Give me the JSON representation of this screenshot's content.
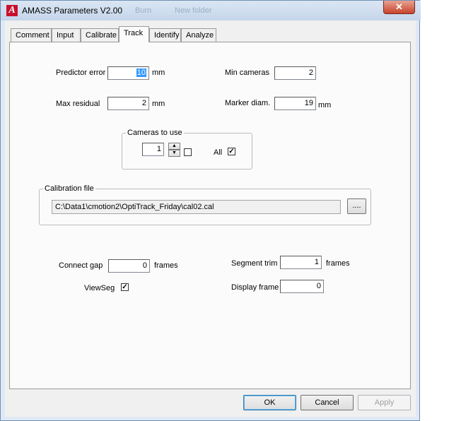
{
  "window": {
    "title": "AMASS Parameters V2.00",
    "ghost_items": [
      "Burn",
      "New folder"
    ],
    "app_icon_letter": "A",
    "close_glyph": "✕"
  },
  "tabs": [
    {
      "label": "Comment",
      "active": false
    },
    {
      "label": "Input",
      "active": false
    },
    {
      "label": "Calibrate",
      "active": false
    },
    {
      "label": "Track",
      "active": true
    },
    {
      "label": "Identify",
      "active": false
    },
    {
      "label": "Analyze",
      "active": false
    }
  ],
  "track": {
    "predictor_error": {
      "label": "Predictor error",
      "value": "10",
      "unit": "mm"
    },
    "max_residual": {
      "label": "Max residual",
      "value": "2",
      "unit": "mm"
    },
    "min_cameras": {
      "label": "Min cameras",
      "value": "2"
    },
    "marker_diam": {
      "label": "Marker diam.",
      "value": "19",
      "unit": "mm"
    },
    "cameras_to_use": {
      "title": "Cameras to use",
      "value": "1",
      "camera_checked": false,
      "all_label": "All",
      "all_checked": true
    },
    "calibration": {
      "title": "Calibration file",
      "path": "C:\\Data1\\cmotion2\\OptiTrack_Friday\\cal02.cal",
      "browse_label": "...."
    },
    "connect_gap": {
      "label": "Connect gap",
      "value": "0",
      "unit": "frames"
    },
    "view_seg": {
      "label": "ViewSeg",
      "checked": true
    },
    "segment_trim": {
      "label": "Segment trim",
      "value": "1",
      "unit": "frames"
    },
    "display_frame": {
      "label": "Display frame",
      "value": "0"
    }
  },
  "buttons": {
    "ok": "OK",
    "cancel": "Cancel",
    "apply": "Apply"
  },
  "glyphs": {
    "check": "✓",
    "spin_up": "▲",
    "spin_down": "▼"
  }
}
